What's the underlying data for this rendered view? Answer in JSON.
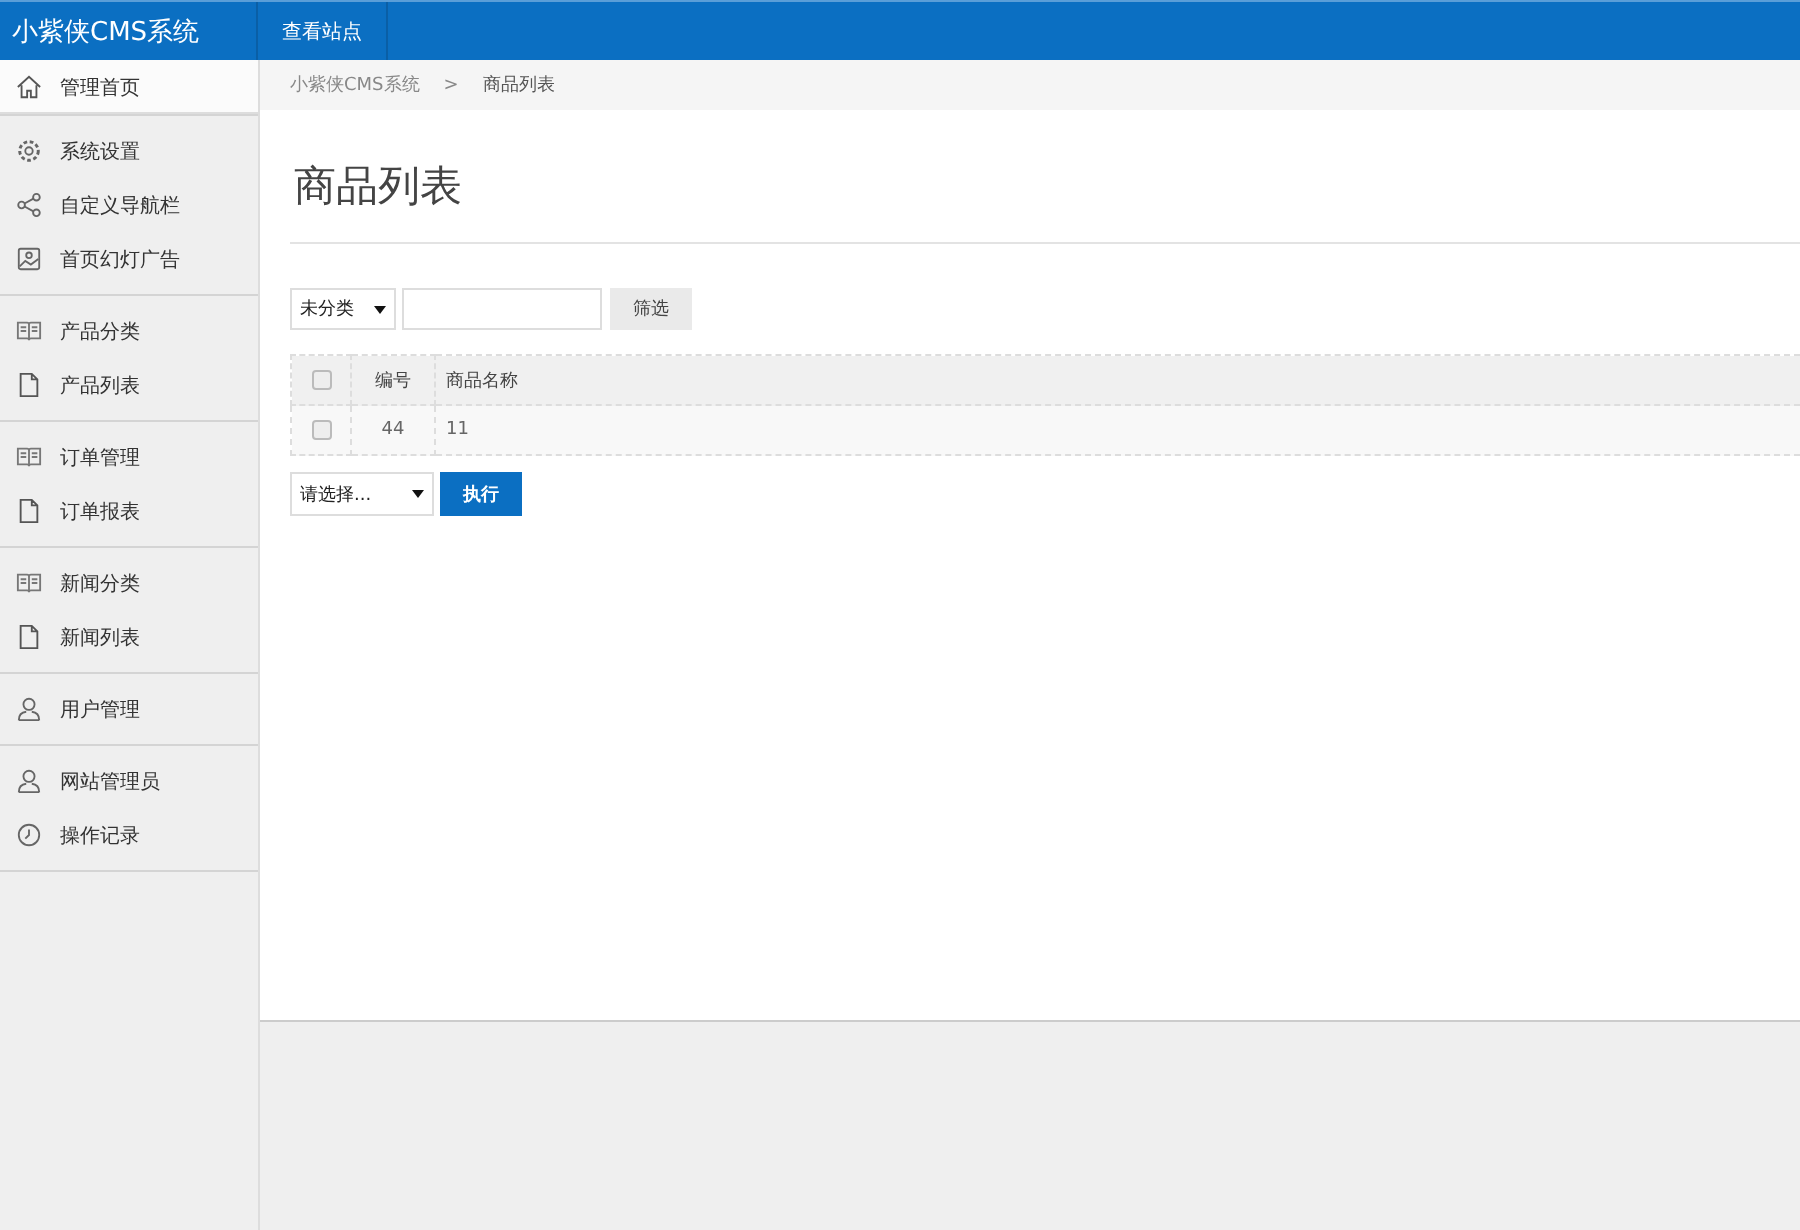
{
  "header": {
    "logo": "小紫侠CMS系统",
    "nav": [
      {
        "label": "查看站点"
      }
    ]
  },
  "sidebar": {
    "groups": [
      {
        "items": [
          {
            "label": "管理首页",
            "kind": "home",
            "selected": true
          }
        ]
      },
      {
        "items": [
          {
            "label": "系统设置",
            "kind": "gear",
            "selected": false
          },
          {
            "label": "自定义导航栏",
            "kind": "share",
            "selected": false
          },
          {
            "label": "首页幻灯广告",
            "kind": "picture",
            "selected": false
          }
        ]
      },
      {
        "items": [
          {
            "label": "产品分类",
            "kind": "book",
            "selected": false
          },
          {
            "label": "产品列表",
            "kind": "file",
            "selected": false
          }
        ]
      },
      {
        "items": [
          {
            "label": "订单管理",
            "kind": "book",
            "selected": false
          },
          {
            "label": "订单报表",
            "kind": "file",
            "selected": false
          }
        ]
      },
      {
        "items": [
          {
            "label": "新闻分类",
            "kind": "book",
            "selected": false
          },
          {
            "label": "新闻列表",
            "kind": "file",
            "selected": false
          }
        ]
      },
      {
        "items": [
          {
            "label": "用户管理",
            "kind": "user",
            "selected": false
          }
        ]
      },
      {
        "items": [
          {
            "label": "网站管理员",
            "kind": "user",
            "selected": false
          },
          {
            "label": "操作记录",
            "kind": "clock",
            "selected": false
          }
        ]
      }
    ]
  },
  "breadcrumb": {
    "items": [
      "小紫侠CMS系统",
      "商品列表"
    ],
    "separator": ">"
  },
  "page_title": "商品列表",
  "filter": {
    "category": "未分类",
    "button": "筛选"
  },
  "table": {
    "columns": [
      "编号",
      "商品名称"
    ],
    "header_checked": false,
    "rows": [
      {
        "checked": false,
        "cells": [
          "44",
          "11"
        ]
      }
    ]
  },
  "bulk": {
    "action": "请选择...",
    "button": "执行"
  }
}
